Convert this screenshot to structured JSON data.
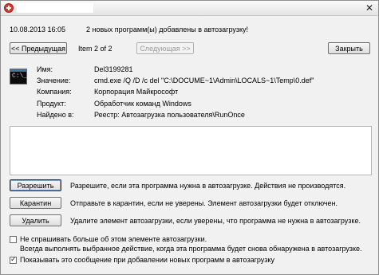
{
  "dialog": {
    "date": "10.08.2013 16:05",
    "message": "2 новых программ(ы) добавлены в автозагрузку!"
  },
  "nav": {
    "prev_label": "<< Предыдущая",
    "item_counter": "Item 2 of 2",
    "next_label": "Следующая >>",
    "close_label": "Закрыть"
  },
  "item": {
    "icon": "cmd-icon",
    "fields": [
      {
        "label": "Имя:",
        "value": "Del3199281"
      },
      {
        "label": "Значение:",
        "value": "cmd.exe /Q /D /c del \"C:\\DOCUME~1\\Admin\\LOCALS~1\\Temp\\0.def\""
      },
      {
        "label": "Компания:",
        "value": "Корпорация Майкрософт"
      },
      {
        "label": "Продукт:",
        "value": "Обработчик команд Windows"
      },
      {
        "label": "Найдено в:",
        "value": "Реестр: Автозагрузка пользователя\\RunOnce"
      }
    ]
  },
  "actions": [
    {
      "label": "Разрешить",
      "desc": "Разрешите, если эта программа нужна в автозагрузке. Действия не производятся."
    },
    {
      "label": "Карантин",
      "desc": "Отправьте в карантин, если не уверены. Элемент автозагрузки будет отключен."
    },
    {
      "label": "Удалить",
      "desc": "Удалите элемент автозагрузки, если уверены, что программа не нужна в автозагрузке."
    }
  ],
  "options": {
    "dont_ask_line1": "Не спрашивать больше об этом элементе автозагрузки.",
    "dont_ask_line2": "Всегда выполнять выбранное действие, когда эта программа будет снова обнаружена в автозагрузке.",
    "dont_ask_checked": false,
    "show_message": "Показывать это сообщение при добавлении новых программ в автозагрузку",
    "show_message_checked": true
  }
}
